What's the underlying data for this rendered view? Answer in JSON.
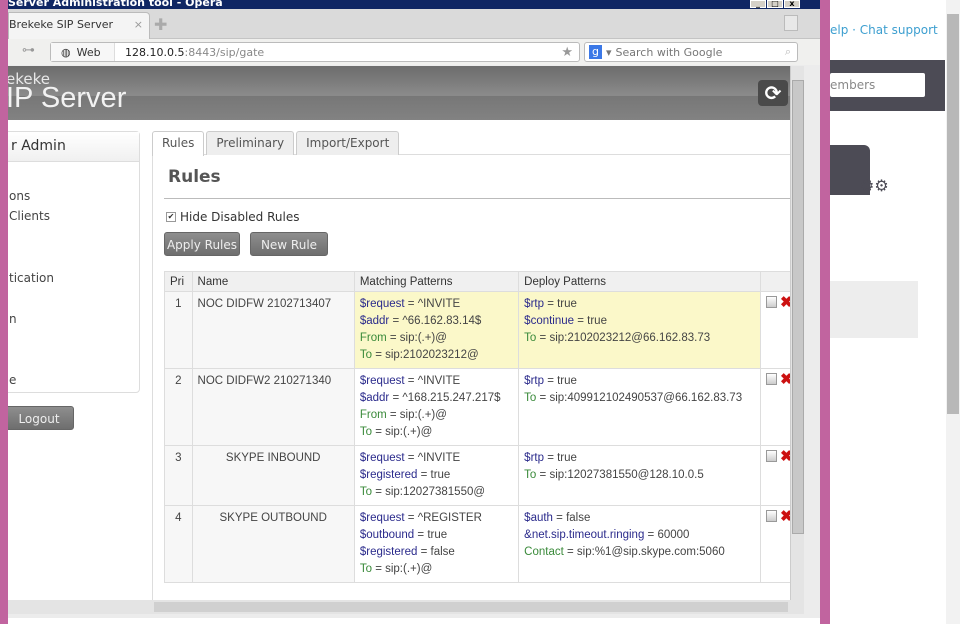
{
  "window": {
    "title": "Server Administration tool - Opera"
  },
  "browser": {
    "tab_label": "Brekeke SIP Server Admi...",
    "address_mode": "Web",
    "url_host": "128.10.0.5",
    "url_rest": ":8443/sip/gate",
    "search_placeholder": "Search with Google"
  },
  "app": {
    "brand_top": "ekeke",
    "brand_main": "IP Server"
  },
  "sidebar": {
    "title": "r Admin",
    "items": [
      "ons",
      "Clients",
      "tication",
      "n",
      "e"
    ],
    "logout": "Logout"
  },
  "tabs": [
    "Rules",
    "Preliminary",
    "Import/Export"
  ],
  "rules": {
    "title": "Rules",
    "hide_disabled_label": "Hide Disabled Rules",
    "hide_disabled_checked": true,
    "apply_label": "Apply Rules",
    "new_label": "New Rule",
    "columns": [
      "Pri",
      "Name",
      "Matching Patterns",
      "Deploy Patterns"
    ],
    "rows": [
      {
        "pri": "1",
        "name": "NOC DIDFW 2102713407",
        "matching": [
          [
            "$request",
            "^INVITE"
          ],
          [
            "$addr",
            "^66.162.83.14$"
          ],
          [
            "From",
            "sip:(.+)@"
          ],
          [
            "To",
            "sip:2102023212@"
          ]
        ],
        "deploy": [
          [
            "$rtp",
            "true"
          ],
          [
            "$continue",
            "true"
          ],
          [
            "To",
            "sip:2102023212@66.162.83.73"
          ]
        ]
      },
      {
        "pri": "2",
        "name": "NOC DIDFW2 210271340",
        "matching": [
          [
            "$request",
            "^INVITE"
          ],
          [
            "$addr",
            "^168.215.247.217$"
          ],
          [
            "From",
            "sip:(.+)@"
          ],
          [
            "To",
            "sip:(.+)@"
          ]
        ],
        "deploy": [
          [
            "$rtp",
            "true"
          ],
          [
            "To",
            "sip:409912102490537@66.162.83.73"
          ]
        ]
      },
      {
        "pri": "3",
        "name": "SKYPE INBOUND",
        "matching": [
          [
            "$request",
            "^INVITE"
          ],
          [
            "$registered",
            "true"
          ],
          [
            "To",
            "sip:12027381550@"
          ]
        ],
        "deploy": [
          [
            "$rtp",
            "true"
          ],
          [
            "To",
            "sip:12027381550@128.10.0.5"
          ]
        ]
      },
      {
        "pri": "4",
        "name": "SKYPE OUTBOUND",
        "matching": [
          [
            "$request",
            "^REGISTER"
          ],
          [
            "$outbound",
            "true"
          ],
          [
            "$registered",
            "false"
          ],
          [
            "To",
            "sip:(.+)@"
          ]
        ],
        "deploy": [
          [
            "$auth",
            "false"
          ],
          [
            "&net.sip.timeout.ringing",
            "60000"
          ],
          [
            "Contact",
            "sip:%1@sip.skype.com:5060"
          ]
        ]
      }
    ]
  },
  "background_page": {
    "links": "elp  ·  Chat support",
    "search_placeholder": "embers"
  },
  "colors": {
    "variable": "#2b2b8c",
    "header_field": "#3a8a3a",
    "highlight_row": "#fbf8c9",
    "delete": "#cc1111",
    "window_frame": "#c1649f"
  }
}
